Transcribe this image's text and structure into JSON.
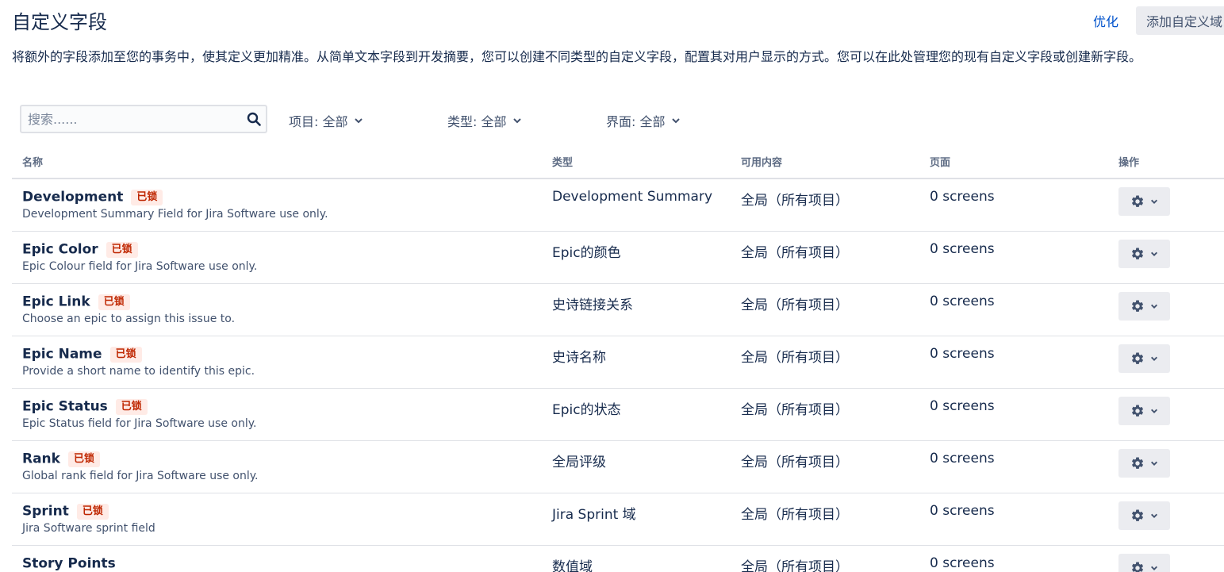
{
  "header": {
    "title": "自定义字段",
    "optimize_label": "优化",
    "add_button_label": "添加自定义域",
    "description": "将额外的字段添加至您的事务中，使其定义更加精准。从简单文本字段到开发摘要，您可以创建不同类型的自定义字段，配置其对用户显示的方式。您可以在此处管理您的现有自定义字段或创建新字段。"
  },
  "filters": {
    "search_placeholder": "搜索......",
    "project": "项目: 全部",
    "type": "类型: 全部",
    "screen": "界面: 全部"
  },
  "table": {
    "columns": [
      "名称",
      "类型",
      "可用内容",
      "页面",
      "操作"
    ],
    "rows": [
      {
        "name": "Development",
        "locked": "已锁",
        "description": "Development Summary Field for Jira Software use only.",
        "type": "Development Summary",
        "context": "全局（所有项目）",
        "screens": "0 screens"
      },
      {
        "name": "Epic Color",
        "locked": "已锁",
        "description": "Epic Colour field for Jira Software use only.",
        "type": "Epic的颜色",
        "context": "全局（所有项目）",
        "screens": "0 screens"
      },
      {
        "name": "Epic Link",
        "locked": "已锁",
        "description": "Choose an epic to assign this issue to.",
        "type": "史诗链接关系",
        "context": "全局（所有项目）",
        "screens": "0 screens"
      },
      {
        "name": "Epic Name",
        "locked": "已锁",
        "description": "Provide a short name to identify this epic.",
        "type": "史诗名称",
        "context": "全局（所有项目）",
        "screens": "0 screens"
      },
      {
        "name": "Epic Status",
        "locked": "已锁",
        "description": "Epic Status field for Jira Software use only.",
        "type": "Epic的状态",
        "context": "全局（所有项目）",
        "screens": "0 screens"
      },
      {
        "name": "Rank",
        "locked": "已锁",
        "description": "Global rank field for Jira Software use only.",
        "type": "全局评级",
        "context": "全局（所有项目）",
        "screens": "0 screens"
      },
      {
        "name": "Sprint",
        "locked": "已锁",
        "description": "Jira Software sprint field",
        "type": "Jira Sprint 域",
        "context": "全局（所有项目）",
        "screens": "0 screens"
      },
      {
        "name": "Story Points",
        "locked": "",
        "description": "",
        "type": "数值域",
        "context": "全局（所有项目）",
        "screens": "0 screens"
      }
    ]
  },
  "icons": {
    "search": "search-icon",
    "filter_chevron": "chevron-down-icon",
    "action_gear": "gear-icon"
  },
  "colors": {
    "link": "#0052cc",
    "lock_badge_bg": "#ffebe6",
    "lock_badge_text": "#bf2600",
    "button_bg": "#ebecf0"
  }
}
